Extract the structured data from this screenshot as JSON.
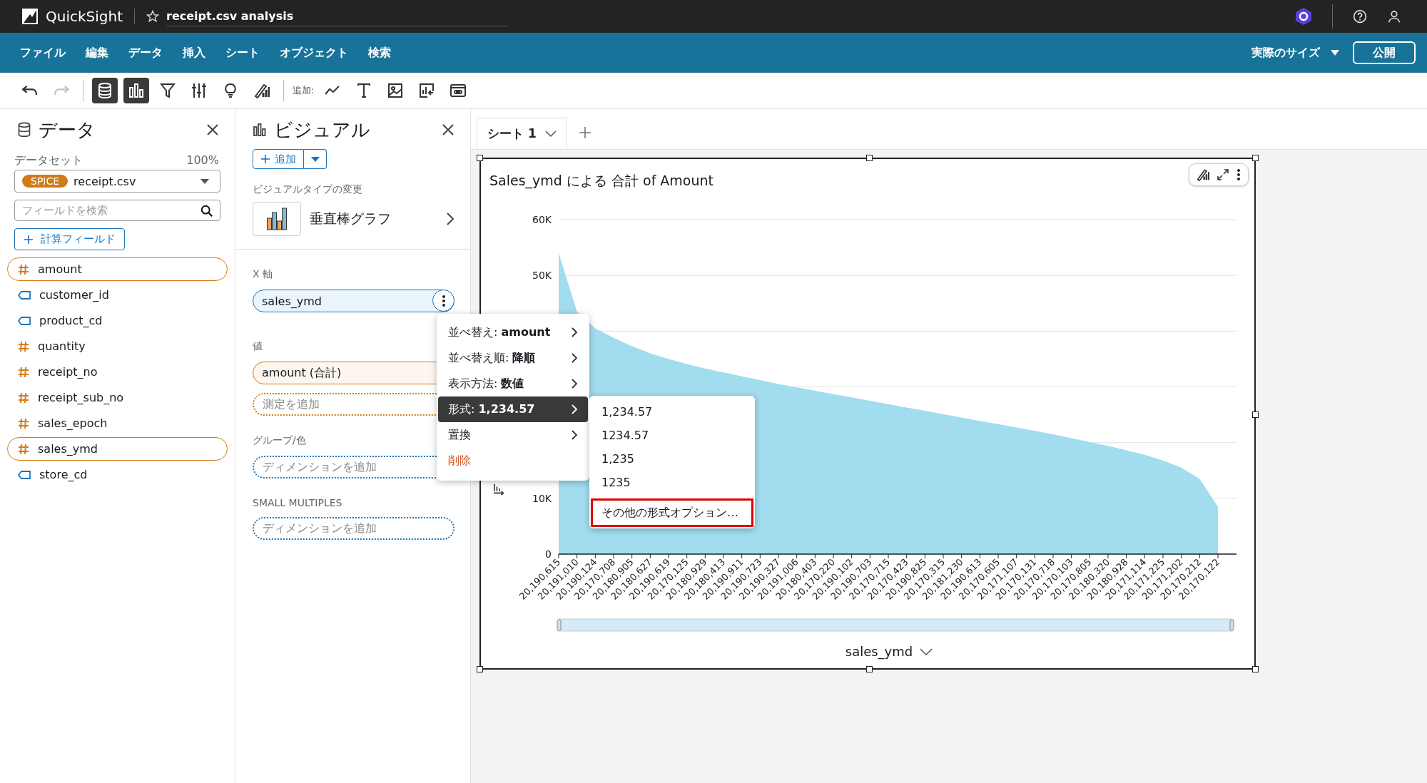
{
  "app": {
    "name": "QuickSight",
    "analysis_title": "receipt.csv analysis"
  },
  "menu_bar": {
    "items": [
      "ファイル",
      "編集",
      "データ",
      "挿入",
      "シート",
      "オブジェクト",
      "検索"
    ],
    "view_size": "実際のサイズ",
    "publish_button": "公開"
  },
  "toolbar": {
    "history": [
      {
        "kind": "undo",
        "disabled": false
      },
      {
        "kind": "redo",
        "disabled": true
      }
    ],
    "panels": [
      {
        "kind": "data",
        "selected": true
      },
      {
        "kind": "visual",
        "selected": true
      },
      {
        "kind": "filter",
        "selected": false
      },
      {
        "kind": "parameters",
        "selected": false
      },
      {
        "kind": "insights",
        "selected": false
      },
      {
        "kind": "format",
        "selected": false
      }
    ],
    "add_label": "追加:",
    "add_items": [
      {
        "kind": "line"
      },
      {
        "kind": "text"
      },
      {
        "kind": "image"
      },
      {
        "kind": "custom"
      },
      {
        "kind": "embed"
      }
    ]
  },
  "data_panel": {
    "title": "データ",
    "dataset_label": "データセット",
    "dataset_percent": "100%",
    "storage_badge": "SPICE",
    "dataset": "receipt.csv",
    "search_placeholder": "フィールドを検索",
    "calc_field_button": "計算フィールド",
    "fields": [
      {
        "name": "amount",
        "kind": "measure",
        "selected": true
      },
      {
        "name": "customer_id",
        "kind": "dimension",
        "selected": false
      },
      {
        "name": "product_cd",
        "kind": "dimension",
        "selected": false
      },
      {
        "name": "quantity",
        "kind": "measure",
        "selected": false
      },
      {
        "name": "receipt_no",
        "kind": "measure",
        "selected": false
      },
      {
        "name": "receipt_sub_no",
        "kind": "measure",
        "selected": false
      },
      {
        "name": "sales_epoch",
        "kind": "measure",
        "selected": false
      },
      {
        "name": "sales_ymd",
        "kind": "measure",
        "selected": true
      },
      {
        "name": "store_cd",
        "kind": "dimension",
        "selected": false
      }
    ]
  },
  "visual_panel": {
    "title": "ビジュアル",
    "add_button": "追加",
    "type_label": "ビジュアルタイプの変更",
    "visual_type": "垂直棒グラフ",
    "wells": [
      {
        "label": "X 軸",
        "kind": "dimension",
        "field": "sales_ymd",
        "menu_open": true
      },
      {
        "label": "値",
        "kind": "measure",
        "field": "amount (合計)",
        "add_placeholder": "測定を追加"
      },
      {
        "label": "グループ/色",
        "kind": "dimension",
        "add_placeholder": "ディメンションを追加"
      },
      {
        "label": "SMALL MULTIPLES",
        "kind": "dimension",
        "add_placeholder": "ディメンションを追加"
      }
    ]
  },
  "sheet_tabs": [
    {
      "label": "シート 1",
      "selected": true
    }
  ],
  "visual": {
    "title": "Sales_ymd による 合計 of Amount",
    "chart_data": {
      "type": "area",
      "xlabel": "sales_ymd",
      "categories": [
        "20,190,615",
        "20,191,010",
        "20,190,124",
        "20,170,708",
        "20,180,905",
        "20,180,627",
        "20,190,619",
        "20,170,125",
        "20,180,929",
        "20,180,413",
        "20,190,911",
        "20,190,723",
        "20,190,327",
        "20,191,006",
        "20,180,403",
        "20,170,220",
        "20,190,102",
        "20,190,703",
        "20,170,715",
        "20,170,423",
        "20,190,825",
        "20,170,315",
        "20,181,230",
        "20,190,613",
        "20,170,605",
        "20,171,107",
        "20,170,131",
        "20,170,718",
        "20,170,103",
        "20,170,805",
        "20,180,320",
        "20,180,928",
        "20,171,114",
        "20,171,225",
        "20,171,202",
        "20,170,212",
        "20,170,122"
      ],
      "series": [
        {
          "color": "#a2dcef",
          "values": [
            54000,
            43500,
            40500,
            38800,
            37300,
            36000,
            35000,
            34100,
            33300,
            32600,
            31900,
            31200,
            30500,
            29900,
            29300,
            28700,
            28100,
            27500,
            26900,
            26300,
            25700,
            25100,
            24500,
            23900,
            23300,
            22700,
            22100,
            21500,
            20800,
            20100,
            19400,
            18600,
            17800,
            16800,
            15500,
            13500,
            8500
          ]
        }
      ],
      "ylim": [
        0,
        60000
      ],
      "yticks": [
        {
          "value": 0,
          "label": "0"
        },
        {
          "value": 10000,
          "label": "10K"
        },
        {
          "value": 50000,
          "label": "50K"
        },
        {
          "value": 60000,
          "label": "60K"
        }
      ]
    }
  },
  "context_menu": {
    "items": [
      {
        "label": "並べ替え: **amount**",
        "kind": "submenu",
        "selected": false
      },
      {
        "label": "並べ替え順: **降順**",
        "kind": "submenu",
        "selected": false
      },
      {
        "label": "表示方法: **数値**",
        "kind": "submenu",
        "selected": false
      },
      {
        "label": "形式: **1,234.57**",
        "kind": "submenu",
        "selected": true
      },
      {
        "label": "置換",
        "kind": "submenu",
        "selected": false
      },
      {
        "label": "削除",
        "kind": "danger",
        "selected": false
      }
    ]
  },
  "format_submenu": {
    "items": [
      {
        "label": "1,234.57",
        "highlighted": false
      },
      {
        "label": "1234.57",
        "highlighted": false
      },
      {
        "label": "1,235",
        "highlighted": false
      },
      {
        "label": "1235",
        "highlighted": false
      },
      {
        "label": "その他の形式オプション…",
        "highlighted": true
      }
    ]
  }
}
